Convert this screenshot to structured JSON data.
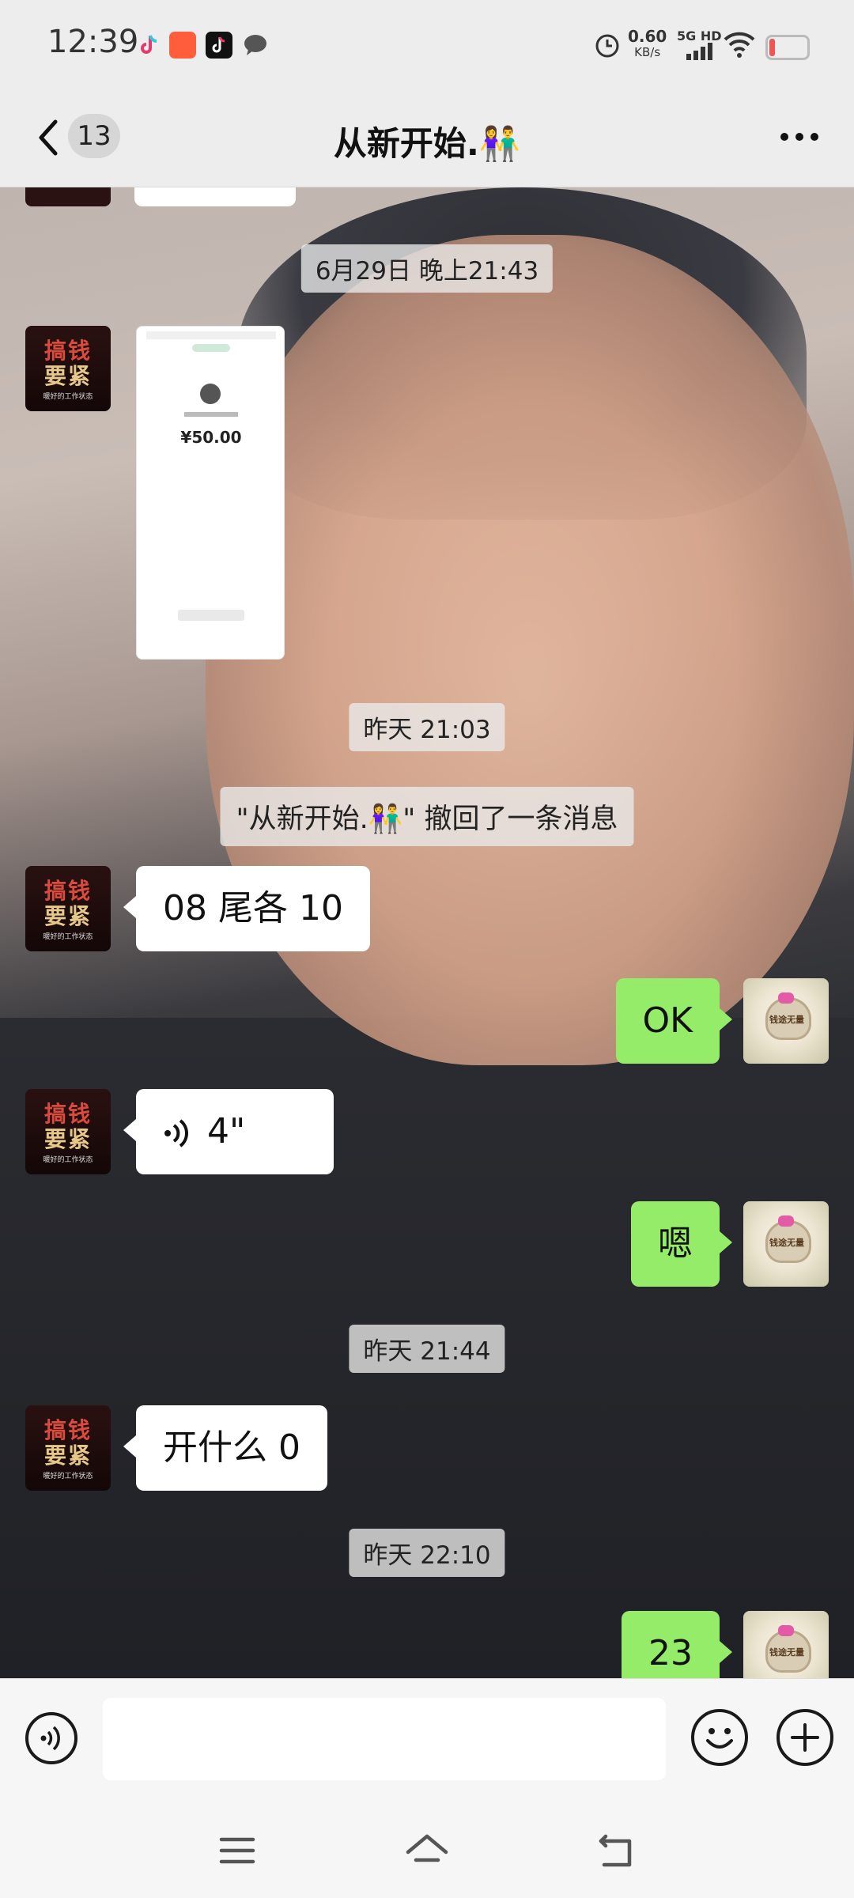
{
  "status_bar": {
    "time": "12:39",
    "net_speed_value": "0.60",
    "net_speed_unit": "KB/s",
    "network": "5G HD",
    "app_icons": [
      "tiktok-lite-icon",
      "gallery-app-icon",
      "tiktok-icon",
      "chat-bubble-icon"
    ],
    "status_icons": [
      "alarm-icon",
      "signal-icon",
      "wifi-icon",
      "battery-icon"
    ],
    "battery_level": 0.15,
    "battery_color": "#f05454"
  },
  "header": {
    "back_icon": "chevron-left-icon",
    "unread_count": "13",
    "title": "从新开始.👫",
    "more_icon": "more-dots-icon"
  },
  "chat": {
    "background": "photo-of-boy",
    "items": [
      {
        "type": "timestamp",
        "text": "6月29日 晚上21:43"
      },
      {
        "type": "image",
        "side": "left",
        "sender_avatar": "搞钱要紧",
        "preview_amount": "¥50.00"
      },
      {
        "type": "timestamp",
        "text": "昨天 21:03"
      },
      {
        "type": "system",
        "text": "\"从新开始.👫\" 撤回了一条消息"
      },
      {
        "type": "text",
        "side": "left",
        "text": "08 尾各 10"
      },
      {
        "type": "text",
        "side": "right",
        "text": "OK"
      },
      {
        "type": "voice",
        "side": "left",
        "text": "4\""
      },
      {
        "type": "text",
        "side": "right",
        "text": "嗯"
      },
      {
        "type": "timestamp",
        "text": "昨天 21:44"
      },
      {
        "type": "text",
        "side": "left",
        "text": "开什么 0"
      },
      {
        "type": "timestamp",
        "text": "昨天 22:10"
      },
      {
        "type": "text",
        "side": "right",
        "text": "23"
      }
    ],
    "left_avatar": {
      "line1": "搞钱",
      "line2": "要紧",
      "small": "暖好的工作状态"
    },
    "right_avatar": {
      "text": "钱途无量"
    }
  },
  "input_bar": {
    "voice_icon": "voice-mode-icon",
    "placeholder": "",
    "emoji_icon": "emoji-icon",
    "plus_icon": "plus-icon"
  },
  "nav_bar": {
    "icons": [
      "menu-icon",
      "home-icon",
      "back-nav-icon"
    ]
  },
  "colors": {
    "bubble_mine": "#95ec69",
    "bubble_other": "#ffffff",
    "header_bg": "#ededed"
  }
}
